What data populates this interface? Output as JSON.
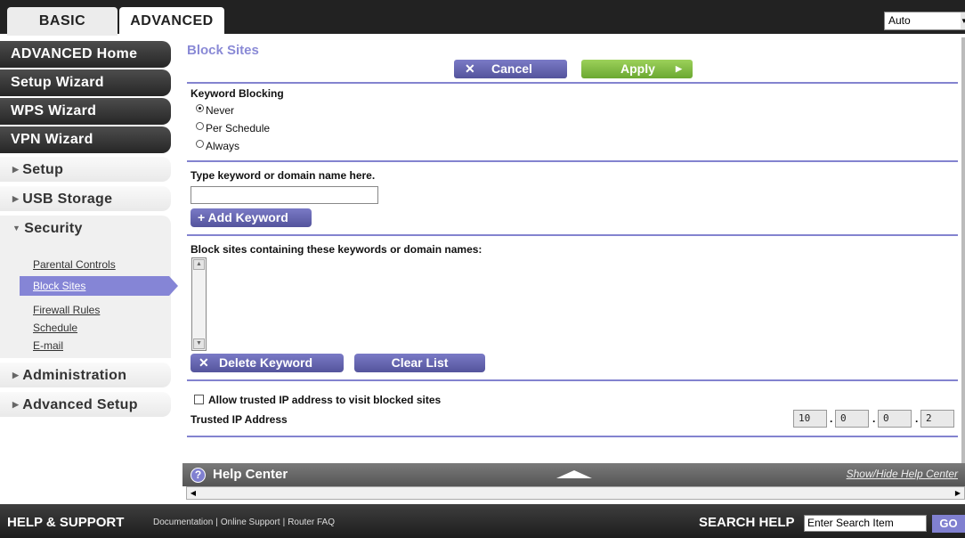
{
  "tabs": {
    "basic": "BASIC",
    "advanced": "ADVANCED"
  },
  "language": {
    "selected": "Auto"
  },
  "sidebar": {
    "advanced_home": "ADVANCED Home",
    "setup_wizard": "Setup Wizard",
    "wps_wizard": "WPS Wizard",
    "vpn_wizard": "VPN Wizard",
    "setup": "Setup",
    "usb_storage": "USB Storage",
    "security": "Security",
    "security_items": [
      "Parental Controls",
      "Block Sites",
      "Firewall Rules",
      "Schedule",
      "E-mail"
    ],
    "administration": "Administration",
    "advanced_setup": "Advanced Setup"
  },
  "main": {
    "title": "Block Sites",
    "cancel_label": "Cancel",
    "apply_label": "Apply",
    "keyword_blocking_label": "Keyword Blocking",
    "radio_never": "Never",
    "radio_per_schedule": "Per Schedule",
    "radio_always": "Always",
    "selected_option": "Never",
    "type_keyword_label": "Type keyword or domain name here.",
    "keyword_value": "",
    "add_keyword_label": "+ Add Keyword",
    "block_list_label": "Block sites containing these keywords or domain names:",
    "delete_keyword_label": "Delete Keyword",
    "clear_list_label": "Clear List",
    "allow_trusted_label": "Allow trusted IP address to visit blocked sites",
    "allow_trusted_checked": false,
    "trusted_ip_label": "Trusted IP Address",
    "trusted_ip": [
      "10",
      "0",
      "0",
      "2"
    ]
  },
  "help": {
    "title": "Help Center",
    "toggle_label": "Show/Hide Help Center"
  },
  "footer": {
    "title": "HELP & SUPPORT",
    "links": [
      "Documentation",
      "Online Support",
      "Router FAQ"
    ],
    "search_label": "SEARCH HELP",
    "search_placeholder": "Enter Search Item",
    "go_label": "GO"
  },
  "colors": {
    "accent": "#8585d6",
    "apply_green": "#7cbb3f",
    "dark_nav": "#333333"
  }
}
